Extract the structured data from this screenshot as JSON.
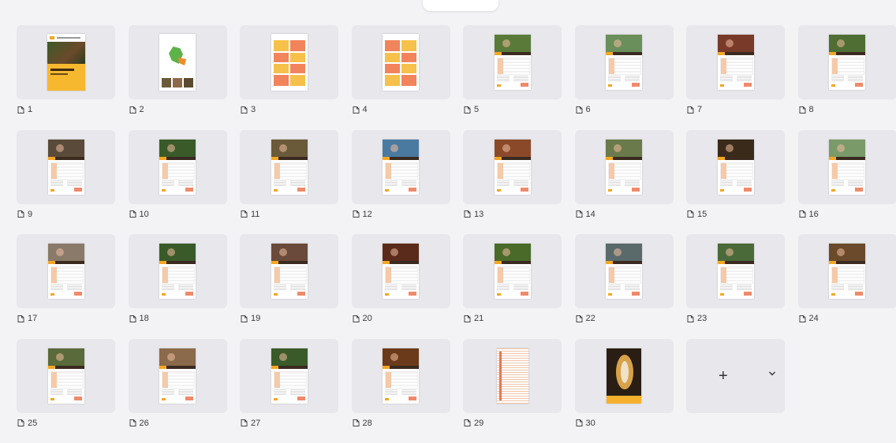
{
  "slides": [
    {
      "number": "1",
      "kind": "cover"
    },
    {
      "number": "2",
      "kind": "map"
    },
    {
      "number": "3",
      "kind": "text-yellow"
    },
    {
      "number": "4",
      "kind": "text-orange"
    },
    {
      "number": "5",
      "kind": "photo",
      "photo": "#5a7a3a"
    },
    {
      "number": "6",
      "kind": "photo",
      "photo": "#6a8f5a"
    },
    {
      "number": "7",
      "kind": "photo",
      "photo": "#7a3a2a"
    },
    {
      "number": "8",
      "kind": "photo",
      "photo": "#4f6e34"
    },
    {
      "number": "9",
      "kind": "photo",
      "photo": "#5a4a3a"
    },
    {
      "number": "10",
      "kind": "photo",
      "photo": "#3a5a2a"
    },
    {
      "number": "11",
      "kind": "photo",
      "photo": "#6a5a3a"
    },
    {
      "number": "12",
      "kind": "photo",
      "photo": "#4a7aa0"
    },
    {
      "number": "13",
      "kind": "photo",
      "photo": "#8a4a2a"
    },
    {
      "number": "14",
      "kind": "photo",
      "photo": "#6a7a4a"
    },
    {
      "number": "15",
      "kind": "photo",
      "photo": "#3a2a1a"
    },
    {
      "number": "16",
      "kind": "photo",
      "photo": "#7a9a6a"
    },
    {
      "number": "17",
      "kind": "photo",
      "photo": "#8a7a6a"
    },
    {
      "number": "18",
      "kind": "photo",
      "photo": "#3a5a2a"
    },
    {
      "number": "19",
      "kind": "photo",
      "photo": "#6a4a3a"
    },
    {
      "number": "20",
      "kind": "photo",
      "photo": "#5a2a1a"
    },
    {
      "number": "21",
      "kind": "photo",
      "photo": "#4a6a2a"
    },
    {
      "number": "22",
      "kind": "photo",
      "photo": "#5a6a6a"
    },
    {
      "number": "23",
      "kind": "photo",
      "photo": "#4a6a3a"
    },
    {
      "number": "24",
      "kind": "photo",
      "photo": "#6a4a2a"
    },
    {
      "number": "25",
      "kind": "photo",
      "photo": "#5a6a3a"
    },
    {
      "number": "26",
      "kind": "photo",
      "photo": "#8a6a4a"
    },
    {
      "number": "27",
      "kind": "photo",
      "photo": "#3a5a2a"
    },
    {
      "number": "28",
      "kind": "photo",
      "photo": "#6a3a1a"
    },
    {
      "number": "29",
      "kind": "table-page"
    },
    {
      "number": "30",
      "kind": "cacao-pod"
    }
  ],
  "add_slide": {
    "plus": "+",
    "chevron": "chevron-down-icon"
  },
  "icons": {
    "slide_label": "slide-page-icon"
  },
  "colors": {
    "background": "#f3f3f6",
    "thumb": "#e7e7ec",
    "accent": "#f5a623",
    "coral": "#f08a6a"
  }
}
